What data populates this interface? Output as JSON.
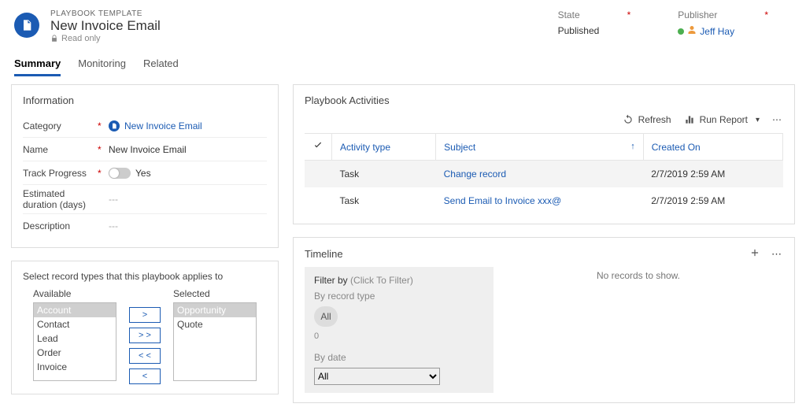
{
  "header": {
    "supertitle": "PLAYBOOK TEMPLATE",
    "title": "New Invoice Email",
    "readonly": "Read only",
    "state_label": "State",
    "state_value": "Published",
    "publisher_label": "Publisher",
    "publisher_value": "Jeff Hay"
  },
  "tabs": [
    "Summary",
    "Monitoring",
    "Related"
  ],
  "info": {
    "title": "Information",
    "rows": {
      "category_label": "Category",
      "category_value": "New Invoice Email",
      "name_label": "Name",
      "name_value": "New Invoice Email",
      "track_label": "Track Progress",
      "track_value": "Yes",
      "duration_label": "Estimated duration (days)",
      "duration_value": "---",
      "description_label": "Description",
      "description_value": "---"
    }
  },
  "recordTypes": {
    "title": "Select record types that this playbook applies to",
    "available_label": "Available",
    "selected_label": "Selected",
    "available": [
      "Account",
      "Contact",
      "Lead",
      "Order",
      "Invoice"
    ],
    "selected": [
      "Opportunity",
      "Quote"
    ],
    "btn_add": ">",
    "btn_add_all": "> >",
    "btn_remove_all": "< <",
    "btn_remove": "<"
  },
  "activities": {
    "title": "Playbook Activities",
    "toolbar": {
      "refresh": "Refresh",
      "run_report": "Run Report"
    },
    "columns": {
      "activity_type": "Activity type",
      "subject": "Subject",
      "created_on": "Created On"
    },
    "rows": [
      {
        "type": "Task",
        "subject": "Change record",
        "created": "2/7/2019 2:59 AM"
      },
      {
        "type": "Task",
        "subject": "Send Email to Invoice xxx@",
        "created": "2/7/2019 2:59 AM"
      }
    ]
  },
  "timeline": {
    "title": "Timeline",
    "filter_by": "Filter by",
    "click_to_filter": "(Click To Filter)",
    "by_record": "By record type",
    "all_chip": "All",
    "count": "0",
    "by_date": "By date",
    "date_all": "All",
    "no_records": "No records to show."
  }
}
